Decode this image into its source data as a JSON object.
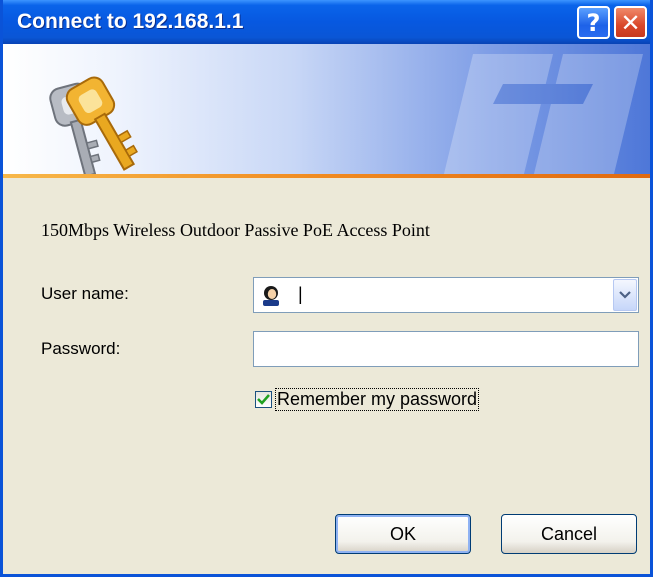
{
  "window": {
    "title": "Connect to 192.168.1.1",
    "help_button": "?",
    "close_button": "✕"
  },
  "dialog": {
    "description": "150Mbps Wireless Outdoor Passive PoE Access Point",
    "username_label": "User name:",
    "username_value": "|",
    "password_label": "Password:",
    "password_value": "",
    "remember_label": "Remember my password",
    "remember_checked": true,
    "ok_label": "OK",
    "cancel_label": "Cancel"
  },
  "icons": {
    "keys": "keys-icon",
    "user": "user-icon",
    "dropdown": "chevron-down-icon",
    "check": "check-icon"
  },
  "colors": {
    "titlebar": "#0a64ea",
    "dialog_bg": "#ece9d8",
    "accent_line": "#f08a20",
    "close_red": "#d9482a"
  }
}
